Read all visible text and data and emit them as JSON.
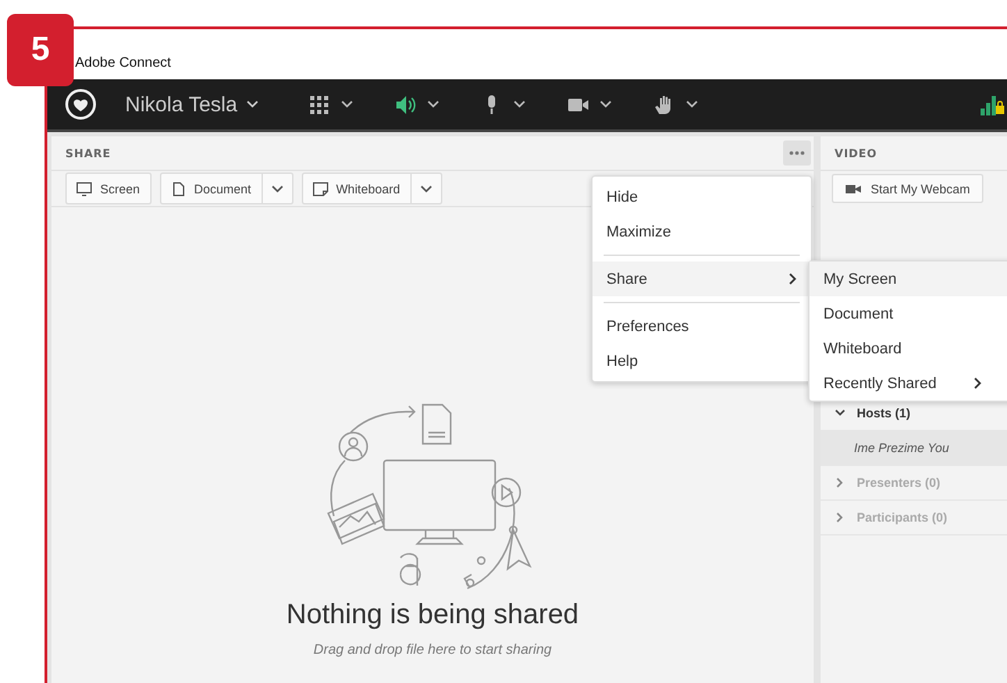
{
  "step_badge": "5",
  "window": {
    "title": "Adobe Connect"
  },
  "toolbar": {
    "user_name": "Nikola Tesla",
    "controls": [
      {
        "kind": "apps"
      },
      {
        "kind": "speaker",
        "active": true
      },
      {
        "kind": "microphone",
        "active": false
      },
      {
        "kind": "camera",
        "active": false
      },
      {
        "kind": "hand",
        "active": false
      }
    ]
  },
  "share_pod": {
    "title": "SHARE",
    "buttons": [
      {
        "label": "Screen",
        "kind": "screen",
        "dropdown": false
      },
      {
        "label": "Document",
        "kind": "document",
        "dropdown": true
      },
      {
        "label": "Whiteboard",
        "kind": "whiteboard",
        "dropdown": true
      }
    ],
    "empty_title": "Nothing is being shared",
    "empty_hint": "Drag and drop file here to start sharing"
  },
  "pod_menu": {
    "items": [
      {
        "kind": "item",
        "label": "Hide",
        "selected": false,
        "submenu": false
      },
      {
        "kind": "item",
        "label": "Maximize",
        "selected": false,
        "submenu": false
      },
      {
        "kind": "separator"
      },
      {
        "kind": "item",
        "label": "Share",
        "selected": true,
        "submenu": true
      },
      {
        "kind": "separator"
      },
      {
        "kind": "item",
        "label": "Preferences",
        "selected": false,
        "submenu": false
      },
      {
        "kind": "item",
        "label": "Help",
        "selected": false,
        "submenu": false
      }
    ]
  },
  "share_submenu": {
    "items": [
      {
        "kind": "item",
        "label": "My Screen",
        "selected": true,
        "submenu": false
      },
      {
        "kind": "item",
        "label": "Document",
        "selected": false,
        "submenu": false
      },
      {
        "kind": "item",
        "label": "Whiteboard",
        "selected": false,
        "submenu": false
      },
      {
        "kind": "item",
        "label": "Recently Shared",
        "selected": false,
        "submenu": true
      }
    ]
  },
  "video_pod": {
    "title": "VIDEO",
    "webcam_button": "Start My Webcam"
  },
  "attendees": [
    {
      "label": "Hosts (1)",
      "expanded": true,
      "disabled": false,
      "children": [
        {
          "label": "Ime Prezime You",
          "selected": true
        }
      ]
    },
    {
      "label": "Presenters (0)",
      "expanded": false,
      "disabled": true
    },
    {
      "label": "Participants (0)",
      "expanded": false,
      "disabled": true
    }
  ]
}
